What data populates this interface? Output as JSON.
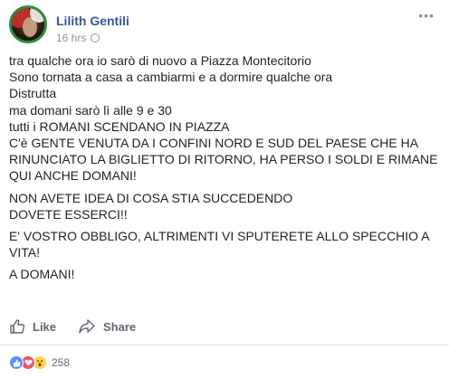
{
  "post": {
    "author": "Lilith Gentili",
    "time": "16 hrs",
    "more_icon": "ellipsis-icon",
    "lines": [
      "tra qualche ora io sarò di nuovo a Piazza Montecitorio",
      "Sono tornata a casa a cambiarmi e a dormire qualche ora",
      "Distrutta",
      "ma domani sarò lì alle 9 e 30",
      "tutti i ROMANI SCENDANO IN PIAZZA",
      "C'è GENTE VENUTA DA I CONFINI NORD E SUD DEL PAESE CHE HA RINUNCIATO LA BIGLIETTO DI RITORNO, HA PERSO I SOLDI E RIMANE QUI ANCHE DOMANI!"
    ],
    "para2": [
      "NON AVETE IDEA DI COSA STIA SUCCEDENDO",
      "DOVETE ESSERCI!!"
    ],
    "para3": "E' VOSTRO OBBLIGO, ALTRIMENTI VI SPUTERETE ALLO SPECCHIO A VITA!",
    "para4": "A DOMANI!"
  },
  "actions": {
    "like_label": "Like",
    "share_label": "Share"
  },
  "reactions": {
    "types": [
      "like",
      "love",
      "wow"
    ],
    "count": "258"
  },
  "colors": {
    "author": "#365899",
    "secondary": "#90949c",
    "action": "#606770"
  }
}
